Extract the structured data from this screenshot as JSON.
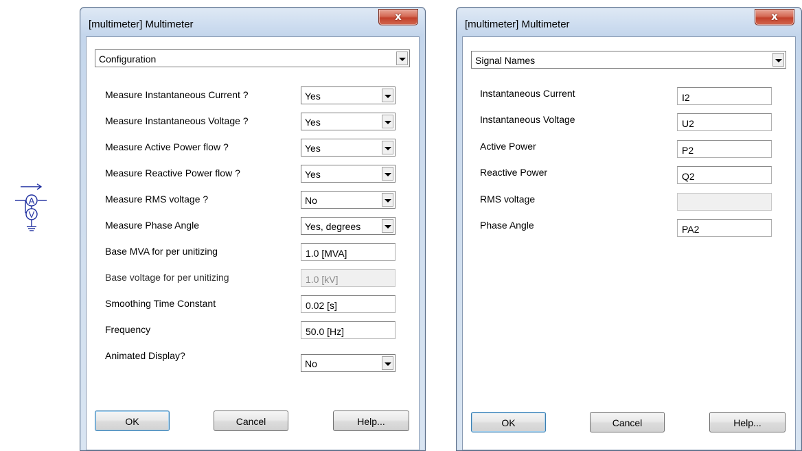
{
  "left_dialog": {
    "title": "[multimeter] Multimeter",
    "close_label": "x",
    "category": "Configuration",
    "rows": [
      {
        "label": "Measure Instantaneous Current ?",
        "value": "Yes"
      },
      {
        "label": "Measure Instantaneous Voltage ?",
        "value": "Yes"
      },
      {
        "label": "Measure Active Power flow ?",
        "value": "Yes"
      },
      {
        "label": "Measure Reactive Power flow ?",
        "value": "Yes"
      },
      {
        "label": "Measure RMS voltage ?",
        "value": "No"
      },
      {
        "label": "Measure Phase Angle",
        "value": "Yes, degrees"
      },
      {
        "label": "Base MVA for per unitizing",
        "value": "1.0 [MVA]"
      },
      {
        "label": "Base voltage for per unitizing",
        "value": "1.0 [kV]"
      },
      {
        "label": "Smoothing Time Constant",
        "value": "0.02 [s]"
      },
      {
        "label": "Frequency",
        "value": "50.0 [Hz]"
      },
      {
        "label": "Animated Display?",
        "value": "No"
      }
    ],
    "buttons": {
      "ok": "OK",
      "cancel": "Cancel",
      "help": "Help..."
    }
  },
  "right_dialog": {
    "title": "[multimeter] Multimeter",
    "close_label": "x",
    "category": "Signal Names",
    "rows": [
      {
        "label": "Instantaneous Current",
        "value": "I2"
      },
      {
        "label": "Instantaneous Voltage",
        "value": "U2"
      },
      {
        "label": "Active Power",
        "value": "P2"
      },
      {
        "label": "Reactive Power",
        "value": "Q2"
      },
      {
        "label": "RMS voltage",
        "value": ""
      },
      {
        "label": "Phase Angle",
        "value": "PA2"
      }
    ],
    "buttons": {
      "ok": "OK",
      "cancel": "Cancel",
      "help": "Help..."
    }
  },
  "symbol": {
    "ammeter_letter": "A",
    "voltmeter_letter": "V"
  },
  "colors": {
    "symbol_blue": "#1f2fa0",
    "close_red": "#c94a35"
  }
}
